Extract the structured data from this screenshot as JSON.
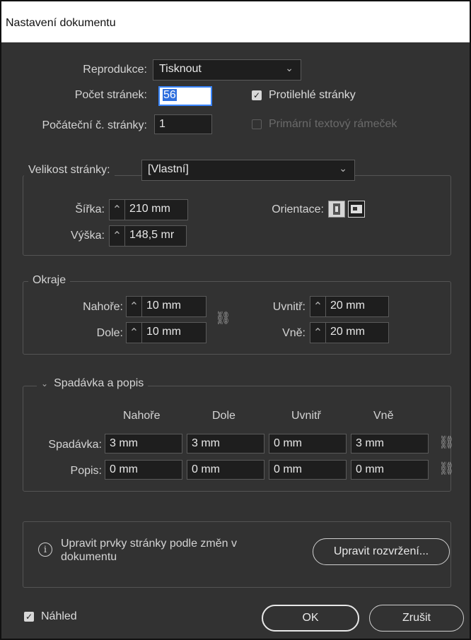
{
  "window": {
    "title": "Nastavení dokumentu"
  },
  "general": {
    "intent_label": "Reprodukce:",
    "intent_value": "Tisknout",
    "pages_label": "Počet stránek:",
    "pages_value": "56",
    "start_label": "Počáteční č. stránky:",
    "start_value": "1",
    "facing_label": "Protilehlé stránky",
    "facing_checked": true,
    "primary_frame_label": "Primární textový rámeček",
    "primary_frame_checked": false
  },
  "page_size": {
    "label": "Velikost stránky:",
    "value": "[Vlastní]",
    "width_label": "Šířka:",
    "width_value": "210 mm",
    "height_label": "Výška:",
    "height_value": "148,5 mr",
    "orientation_label": "Orientace:"
  },
  "margins": {
    "legend": "Okraje",
    "top_label": "Nahoře:",
    "top_value": "10 mm",
    "bottom_label": "Dole:",
    "bottom_value": "10 mm",
    "inside_label": "Uvnitř:",
    "inside_value": "20 mm",
    "outside_label": "Vně:",
    "outside_value": "20 mm"
  },
  "bleed_slug": {
    "legend": "Spadávka a popis",
    "columns": [
      "Nahoře",
      "Dole",
      "Uvnitř",
      "Vně"
    ],
    "bleed_label": "Spadávka:",
    "bleed_values": [
      "3 mm",
      "3 mm",
      "0 mm",
      "3 mm"
    ],
    "slug_label": "Popis:",
    "slug_values": [
      "0 mm",
      "0 mm",
      "0 mm",
      "0 mm"
    ]
  },
  "adjust": {
    "info_text": "Upravit prvky stránky podle změn v dokumentu",
    "button_label": "Upravit rozvržení..."
  },
  "footer": {
    "preview_label": "Náhled",
    "preview_checked": true,
    "ok_label": "OK",
    "cancel_label": "Zrušit"
  }
}
